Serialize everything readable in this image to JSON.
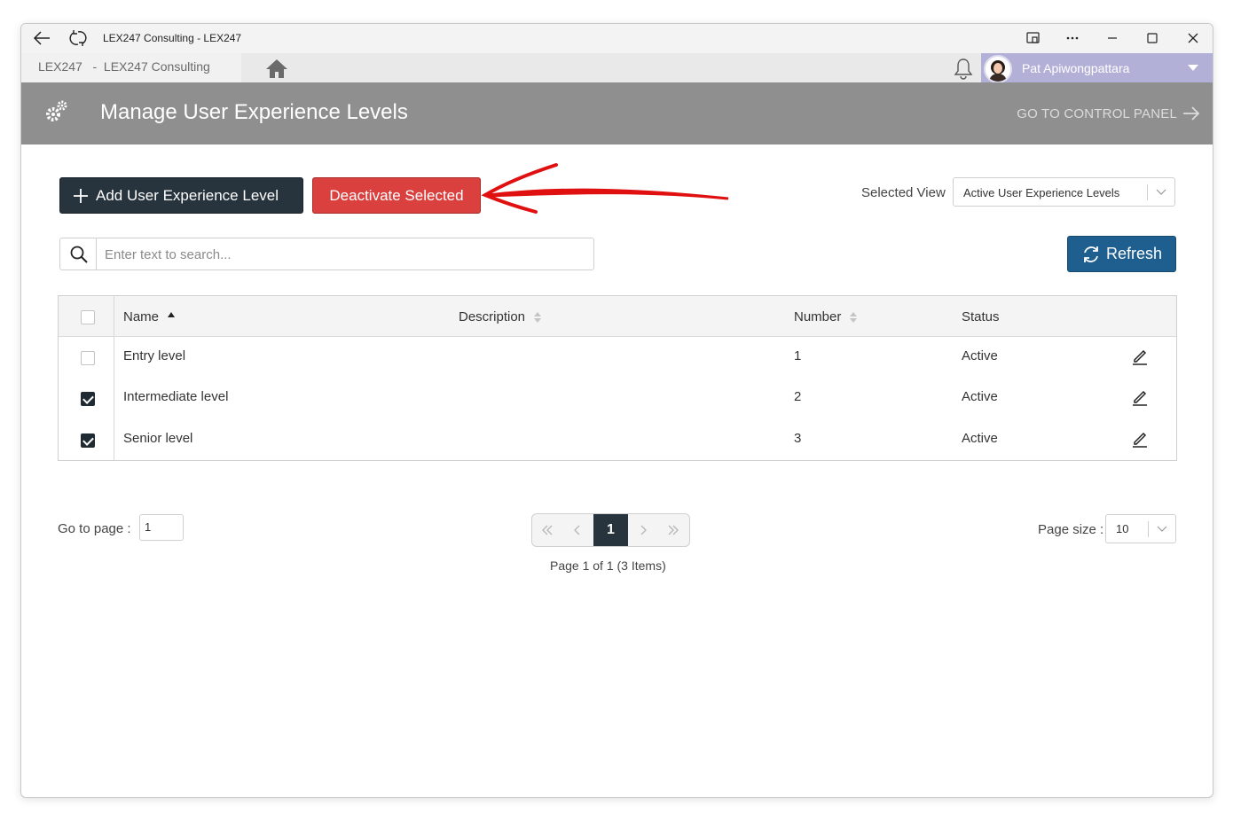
{
  "window": {
    "title": "LEX247 Consulting - LEX247"
  },
  "nav": {
    "breadcrumb": "LEX247   -  LEX247 Consulting",
    "user_name": "Pat Apiwongpattara"
  },
  "header": {
    "title": "Manage User Experience Levels",
    "control_panel_link": "GO TO CONTROL PANEL"
  },
  "toolbar": {
    "add_label": "Add User Experience Level",
    "deactivate_label": "Deactivate Selected",
    "selected_view_label": "Selected View",
    "selected_view_value": "Active User Experience Levels",
    "refresh_label": "Refresh"
  },
  "search": {
    "placeholder": "Enter text to search..."
  },
  "table": {
    "columns": {
      "name": "Name",
      "description": "Description",
      "number": "Number",
      "status": "Status"
    },
    "rows": [
      {
        "name": "Entry level",
        "description": "",
        "number": "1",
        "status": "Active",
        "checked": false
      },
      {
        "name": "Intermediate level",
        "description": "",
        "number": "2",
        "status": "Active",
        "checked": true
      },
      {
        "name": "Senior level",
        "description": "",
        "number": "3",
        "status": "Active",
        "checked": true
      }
    ]
  },
  "pagination": {
    "goto_label": "Go to page :",
    "goto_value": "1",
    "current_page": "1",
    "info": "Page 1 of 1 (3 Items)",
    "page_size_label": "Page size :",
    "page_size_value": "10"
  },
  "colors": {
    "primary_dark": "#27333d",
    "danger": "#d9403e",
    "refresh": "#1f5f8f",
    "header_bg": "#8f8f8f",
    "user_bg": "#b3b0d8",
    "annotation": "#e01010"
  },
  "icons": [
    "back-icon",
    "reload-icon",
    "home-icon",
    "bell-icon",
    "gears-icon",
    "arrow-right-icon",
    "plus-icon",
    "search-icon",
    "refresh-icon",
    "edit-icon",
    "chevron-down-icon"
  ]
}
